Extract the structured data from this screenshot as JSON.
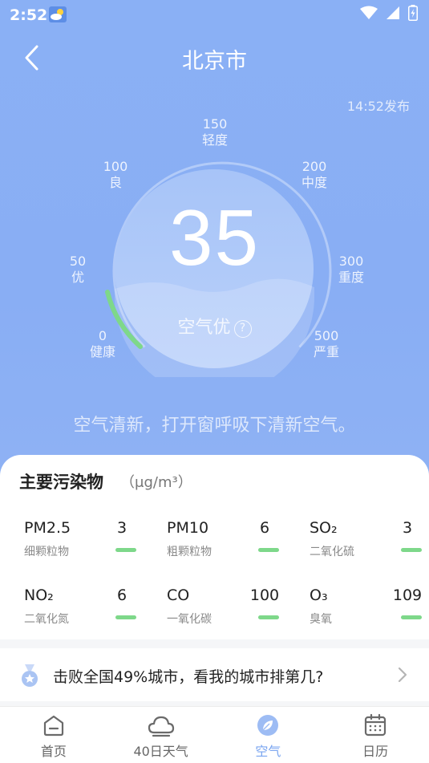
{
  "status": {
    "time": "2:52"
  },
  "header": {
    "title": "北京市",
    "publish_time": "14:52发布"
  },
  "gauge": {
    "scale": [
      {
        "value": "0",
        "label": "健康"
      },
      {
        "value": "50",
        "label": "优"
      },
      {
        "value": "100",
        "label": "良"
      },
      {
        "value": "150",
        "label": "轻度"
      },
      {
        "value": "200",
        "label": "中度"
      },
      {
        "value": "300",
        "label": "重度"
      },
      {
        "value": "500",
        "label": "严重"
      }
    ],
    "aqi": "35",
    "level": "空气优",
    "help": "?",
    "accent_color": "#7ed88a"
  },
  "tip": "空气清新，打开窗呼吸下清新空气。",
  "pollutants": {
    "title": "主要污染物",
    "unit": "（μg/m³）",
    "items": [
      {
        "name": "PM2.5",
        "cn": "细颗粒物",
        "value": "3"
      },
      {
        "name": "PM10",
        "cn": "粗颗粒物",
        "value": "6"
      },
      {
        "name": "SO₂",
        "cn": "二氧化硫",
        "value": "3"
      },
      {
        "name": "NO₂",
        "cn": "二氧化氮",
        "value": "6"
      },
      {
        "name": "CO",
        "cn": "一氧化碳",
        "value": "100"
      },
      {
        "name": "O₃",
        "cn": "臭氧",
        "value": "109"
      }
    ]
  },
  "rank": {
    "text": "击败全国49%城市，看我的城市排第几?"
  },
  "tabs": [
    {
      "label": "首页",
      "icon": "home-icon"
    },
    {
      "label": "40日天气",
      "icon": "cloud-icon"
    },
    {
      "label": "空气",
      "icon": "leaf-icon"
    },
    {
      "label": "日历",
      "icon": "calendar-icon"
    }
  ]
}
